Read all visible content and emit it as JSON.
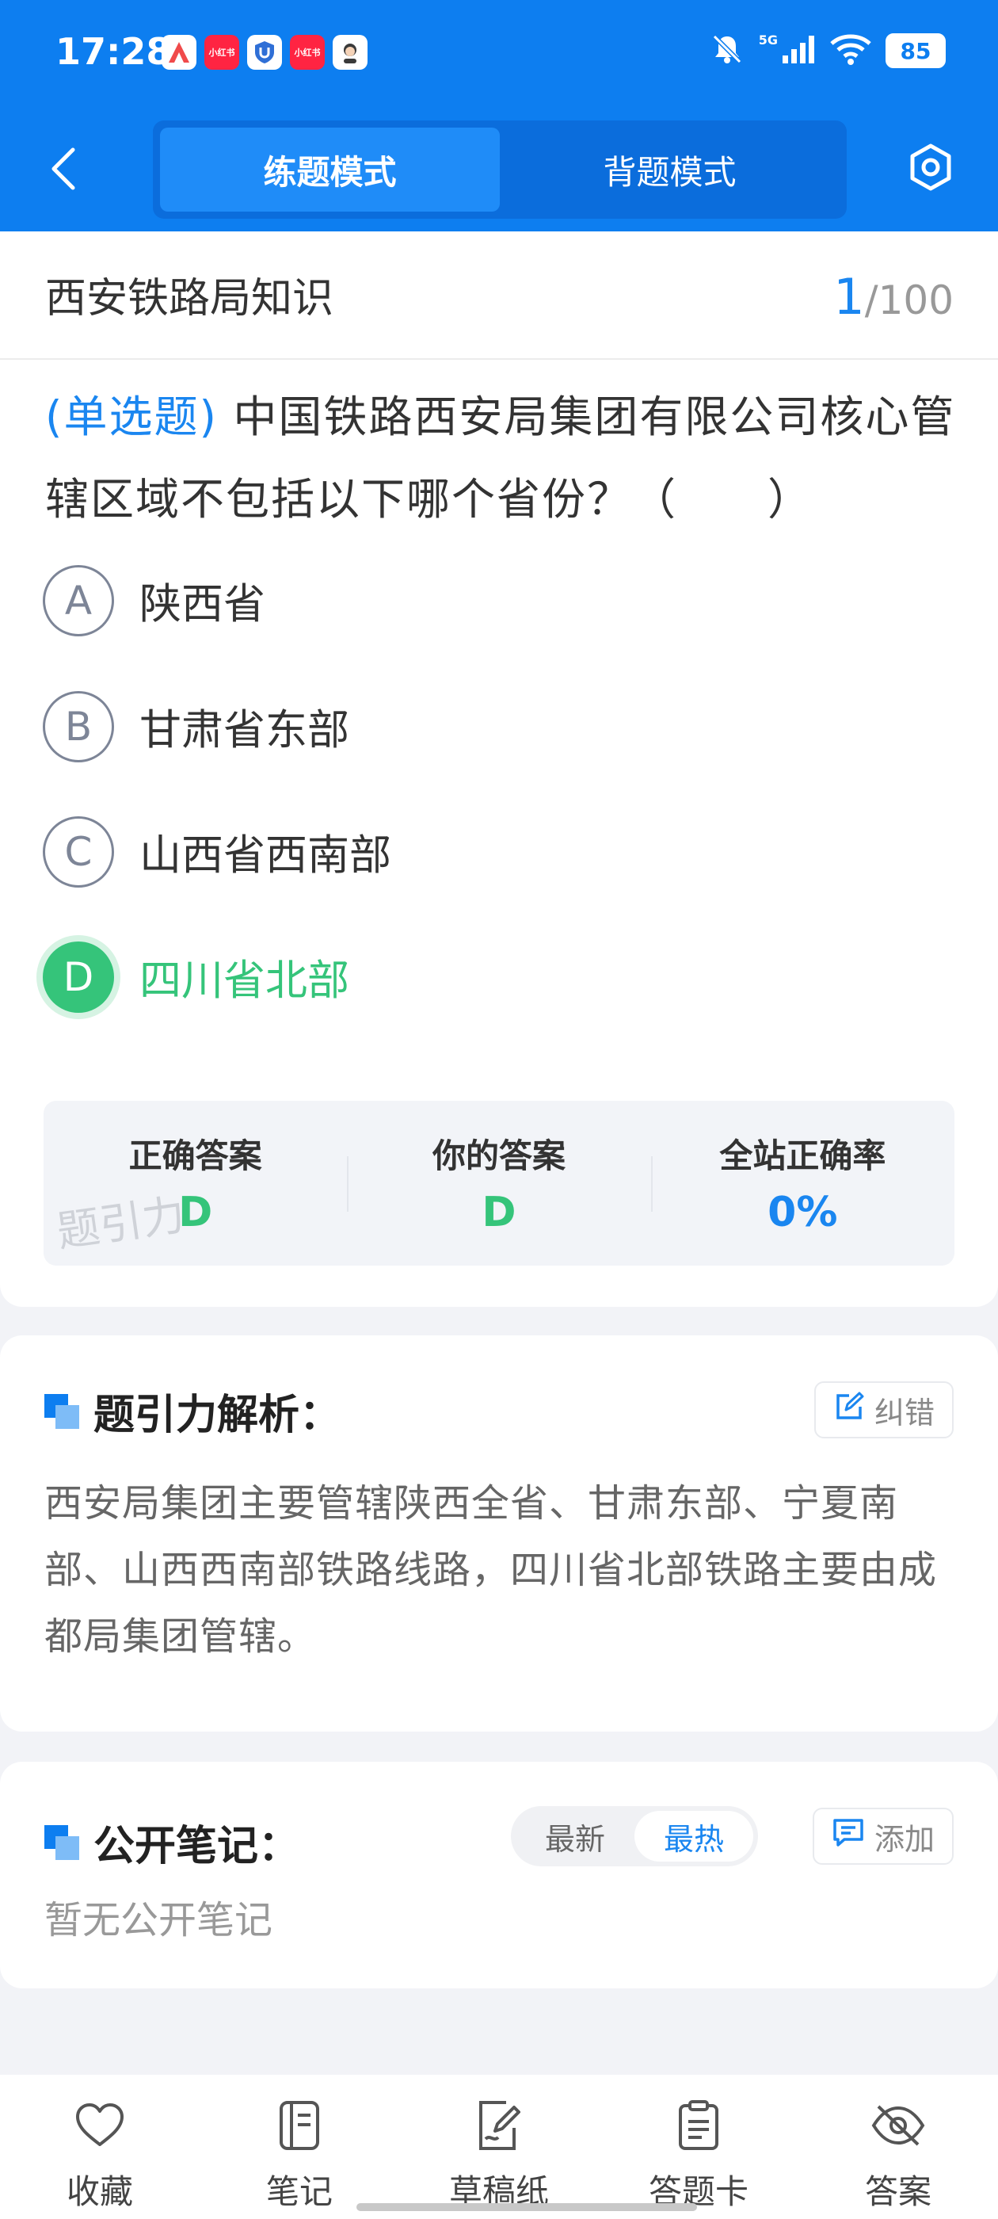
{
  "status_bar": {
    "time": "17:28",
    "battery": "85",
    "network": "5G",
    "app_icons": [
      {
        "name": "app-a-icon",
        "label": "A",
        "color": "#f04a4a"
      },
      {
        "name": "xiaohongshu-icon",
        "label": "小红书",
        "color": "#ff2442"
      },
      {
        "name": "shield-u-icon",
        "label": "U",
        "color": "#2f6fd6"
      },
      {
        "name": "xiaohongshu-icon-2",
        "label": "小红书",
        "color": "#ff2442"
      },
      {
        "name": "avatar-app-icon",
        "label": "",
        "color": "#ffffff"
      }
    ]
  },
  "header": {
    "modes": [
      "练题模式",
      "背题模式"
    ],
    "active_mode_index": 0
  },
  "quiz": {
    "bank_title": "西安铁路局知识",
    "current": "1",
    "total": "/100",
    "question_type": "(单选题)",
    "question_text": "中国铁路西安局集团有限公司核心管辖区域不包括以下哪个省份？（　　）",
    "options": [
      {
        "letter": "A",
        "text": "陕西省"
      },
      {
        "letter": "B",
        "text": "甘肃省东部"
      },
      {
        "letter": "C",
        "text": "山西省西南部"
      },
      {
        "letter": "D",
        "text": "四川省北部"
      }
    ],
    "correct_option": "D"
  },
  "answer_summary": {
    "correct_label": "正确答案",
    "correct_value": "D",
    "yours_label": "你的答案",
    "yours_value": "D",
    "rate_label": "全站正确率",
    "rate_value": "0%",
    "watermark": "题引力"
  },
  "analysis": {
    "title": "题引力解析：",
    "report_label": "纠错",
    "text": "西安局集团主要管辖陕西全省、甘肃东部、宁夏南部、山西西南部铁路线路，四川省北部铁路主要由成都局集团管辖。"
  },
  "notes": {
    "title": "公开笔记：",
    "sort_options": [
      "最新",
      "最热"
    ],
    "active_sort_index": 1,
    "add_label": "添加",
    "empty_text": "暂无公开笔记"
  },
  "bottom_nav": [
    {
      "label": "收藏",
      "icon": "heart-icon"
    },
    {
      "label": "笔记",
      "icon": "notebook-icon"
    },
    {
      "label": "草稿纸",
      "icon": "draft-pen-icon"
    },
    {
      "label": "答题卡",
      "icon": "answer-sheet-icon"
    },
    {
      "label": "答案",
      "icon": "eye-off-icon"
    }
  ],
  "colors": {
    "primary": "#0d7ef0",
    "correct": "#35c47a",
    "accent_text": "#1a86f0"
  }
}
